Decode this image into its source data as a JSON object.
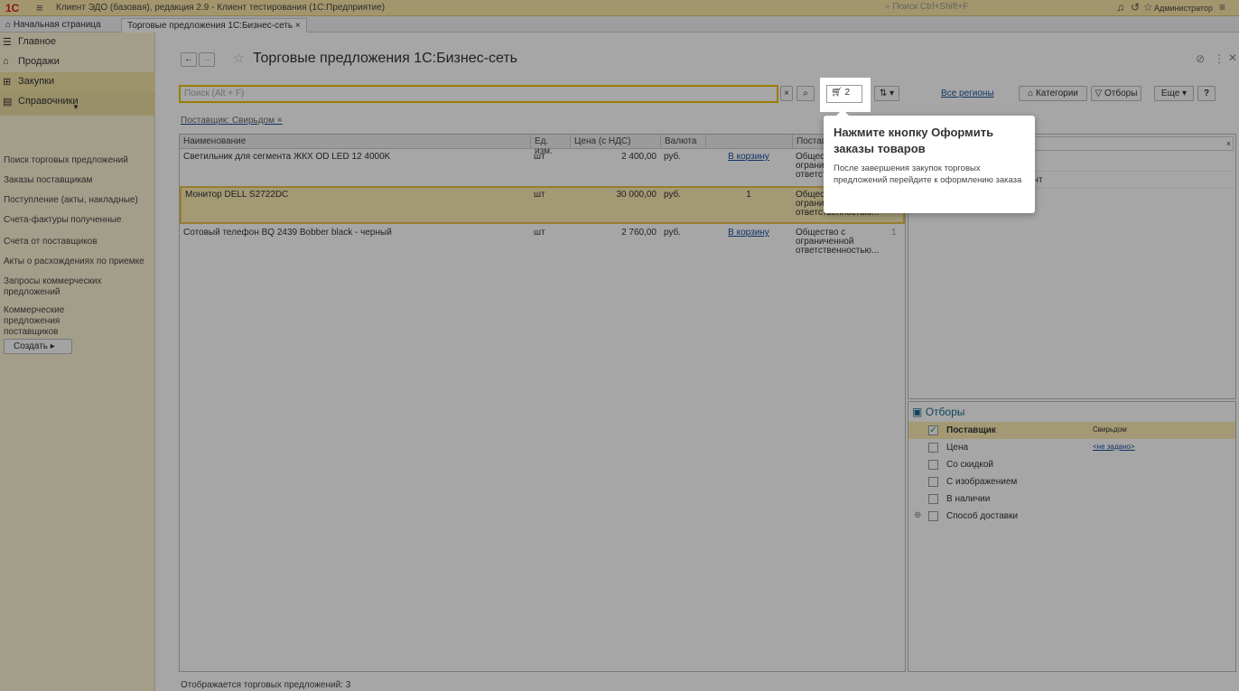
{
  "titlebar": {
    "logo": "1С",
    "title": "Клиент ЭДО (базовая), редакция 2.9  - Клиент тестирования (1С:Предприятие)",
    "search_placeholder": "Поиск Ctrl+Shift+F",
    "user": "Администратор"
  },
  "tabs": [
    {
      "label": "Начальная страница"
    },
    {
      "label": "Торговые предложения 1С:Бизнес-сеть ×"
    }
  ],
  "sidebar": {
    "sections": [
      {
        "label": "Главное",
        "icon": "menu-icon"
      },
      {
        "label": "Продажи",
        "icon": "sales-icon"
      },
      {
        "label": "Закупки",
        "icon": "cart-icon"
      },
      {
        "label": "Справочники",
        "icon": "book-icon"
      }
    ],
    "links": [
      "Поиск торговых предложений",
      "Заказы поставщикам",
      "Поступление (акты, накладные)",
      "Счета-фактуры полученные",
      "Счета от поставщиков",
      "Акты о расхождениях по приемке",
      "Запросы коммерческих предложений",
      "Коммерческие предложения поставщиков"
    ],
    "create_label": "Создать"
  },
  "main": {
    "title": "Торговые предложения 1С:Бизнес-сеть",
    "search_placeholder": "Поиск (Alt + F)",
    "cart_count": "2",
    "all_regions": "Все регионы",
    "categories": "Категории",
    "filters_btn": "Отборы",
    "more": "Еще",
    "help": "?",
    "filter_chip": "Поставщик: Свирьдом",
    "status": "Отображается торговых предложений: 3"
  },
  "grid": {
    "columns": [
      "Наименование",
      "Ед. изм.",
      "Цена (с НДС)",
      "Валюта",
      "",
      "Поставщик"
    ],
    "rows": [
      {
        "name": "Светильник для сегмента ЖКХ OD LED 12 4000K",
        "unit": "шт",
        "price": "2 400,00",
        "currency": "руб.",
        "action": "В корзину",
        "supplier": "Общество с ограниченной ответственностью..."
      },
      {
        "name": "Монитор DELL S2722DC",
        "unit": "шт",
        "price": "30 000,00",
        "currency": "руб.",
        "action": "1",
        "supplier": "Общество с ограниченной ответственностью..."
      },
      {
        "name": "Сотовый телефон BQ 2439 Bobber black - черный",
        "unit": "шт",
        "price": "2 760,00",
        "currency": "руб.",
        "action": "В корзину",
        "supplier": "Общество с ограниченной ответственностью...",
        "extra": "1"
      }
    ]
  },
  "categories_panel": {
    "partial_item": "монт"
  },
  "filters_panel": {
    "title": "Отборы",
    "items": [
      {
        "label": "Поставщик",
        "checked": true,
        "value": "Свирьдом"
      },
      {
        "label": "Цена",
        "checked": false,
        "value": "<не задано>"
      },
      {
        "label": "Со скидкой",
        "checked": false,
        "value": ""
      },
      {
        "label": "С изображением",
        "checked": false,
        "value": ""
      },
      {
        "label": "В наличии",
        "checked": false,
        "value": ""
      },
      {
        "label": "Способ доставки",
        "checked": false,
        "value": ""
      }
    ]
  },
  "tooltip": {
    "heading": "Нажмите кнопку Оформить заказы товаров",
    "body": "После завершения закупок торговых предложений перейдите к оформлению заказа"
  }
}
